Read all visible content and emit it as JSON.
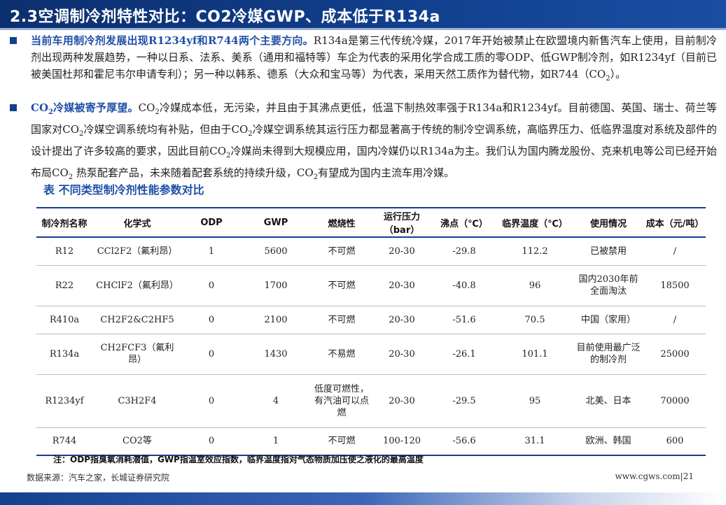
{
  "header": {
    "title": "2.3空调制冷剂特性对比：CO2冷媒GWP、成本低于R134a"
  },
  "bullet1": {
    "lead": "当前车用制冷剂发展出现R1234yf和R744两个主要方向。",
    "body": "R134a是第三代传统冷媒，2017年开始被禁止在欧盟境内新售汽车上使用，目前制冷剂出现两种发展趋势，一种以日系、法系、美系（通用和福特等）车企为代表的采用化学合成工质的零ODP、低GWP制冷剂，如R1234yf（目前已被美国杜邦和霍尼韦尔申请专利）；另一种以韩系、德系（大众和宝马等）为代表，采用天然工质作为替代物，如R744（CO",
    "sub": "2",
    "tail": "）。"
  },
  "bullet2": {
    "lead_a": "CO",
    "lead_sub": "2",
    "lead_b": "冷媒被寄予厚望。",
    "p1": "CO",
    "s1": "2",
    "p2": "冷媒成本低，无污染，并且由于其沸点更低，低温下制热效率强于R134a和R1234yf。目前德国、英国、瑞士、荷兰等国家对CO",
    "s2": "2",
    "p3": "冷媒空调系统均有补贴，但由于CO",
    "s3": "2",
    "p4": "冷媒空调系统其运行压力都显著高于传统的制冷空调系统，高临界压力、低临界温度对系统及部件的设计提出了许多较高的要求，因此目前CO",
    "s4": "2",
    "p5": "冷媒尚未得到大规模应用，国内冷媒仍以R134a为主。我们认为国内腾龙股份、克来机电等公司已经开始布局CO",
    "s5": "2",
    "p6": " 热泵配套产品，未来随着配套系统的持续升级，CO",
    "s6": "2",
    "p7": "有望成为国内主流车用冷媒。"
  },
  "table": {
    "title": "表 不同类型制冷剂性能参数对比",
    "headers": [
      "制冷剂名称",
      "化学式",
      "ODP",
      "GWP",
      "燃烧性",
      "运行压力（bar）",
      "沸点（℃）",
      "临界温度（℃）",
      "使用情况",
      "成本（元/吨）"
    ],
    "rows": [
      [
        "R12",
        "CCl2F2（氟利昂）",
        "1",
        "5600",
        "不可燃",
        "20-30",
        "-29.8",
        "112.2",
        "已被禁用",
        "/"
      ],
      [
        "R22",
        "CHClF2（氟利昂）",
        "0",
        "1700",
        "不可燃",
        "20-30",
        "-40.8",
        "96",
        "国内2030年前全面淘汰",
        "18500"
      ],
      [
        "R410a",
        "CH2F2&C2HF5",
        "0",
        "2100",
        "不可燃",
        "20-30",
        "-51.6",
        "70.5",
        "中国（家用）",
        "/"
      ],
      [
        "R134a",
        "CH2FCF3（氟利昂）",
        "0",
        "1430",
        "不易燃",
        "20-30",
        "-26.1",
        "101.1",
        "目前使用最广泛的制冷剂",
        "25000"
      ],
      [
        "R1234yf",
        "C3H2F4",
        "0",
        "4",
        "低度可燃性，有汽油可以点燃",
        "20-30",
        "-29.5",
        "95",
        "北美、日本",
        "70000"
      ],
      [
        "R744",
        "CO2等",
        "0",
        "1",
        "不可燃",
        "100-120",
        "-56.6",
        "31.1",
        "欧洲、韩国",
        "600"
      ]
    ]
  },
  "note": "注：ODP指臭氧消耗潜值，GWP指温室效应指数，临界温度指对气态物质加压使之液化的最高温度",
  "source": "数据来源：汽车之家，长城证券研究院",
  "site": "www.cgws.com|21",
  "colors": {
    "brand_blue": "#12408f",
    "lead_blue": "#1f4fa8"
  }
}
